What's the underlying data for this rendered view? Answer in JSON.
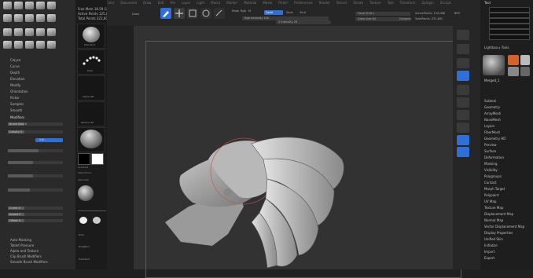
{
  "menubar": {
    "items": [
      "Alpha",
      "Brush",
      "Color",
      "Document",
      "Draw",
      "Edit",
      "File",
      "Layer",
      "Light",
      "Macro",
      "Marker",
      "Material",
      "Movie",
      "Picker",
      "Preferences",
      "Render",
      "Stencil",
      "Stroke",
      "Texture",
      "Tool",
      "Transform",
      "Zplugin",
      "Zscript",
      "Help"
    ]
  },
  "top_status": {
    "line1": "Free Mem 18.59 GB",
    "line2": "Active Points 125,068",
    "line3": "Total Points 321,600"
  },
  "toolbar": {
    "labels": {
      "draw": "Draw",
      "move": "Move",
      "scale": "Scale",
      "rotate": "Rotate",
      "mrgb": "Mrgb",
      "rgb": "Rgb",
      "m": "M",
      "zadd": "Zadd",
      "zsub": "Zsub",
      "zcut": "Zcut",
      "rgb_intensity": "Rgb Intensity 100",
      "z_intensity": "Z Intensity 25",
      "focal_shift": "Focal Shift 0",
      "draw_size": "Draw Size 64",
      "dynamic": "Dynamic",
      "active_points": "ActivePoints: 125,068",
      "total_points": "TotalPoints: 321,600"
    },
    "accent_color": "#2f6fd6"
  },
  "left_panel": {
    "menu": [
      "Clayce",
      "Curve",
      "Depth",
      "Elevation",
      "Modify",
      "Orientation",
      "Picker",
      "Samples",
      "Smooth",
      "Stroke",
      "Surface",
      "Twist"
    ],
    "section_header": "Modifiers",
    "sliders": [
      {
        "label": "Brush Mod 0",
        "level": 0.0
      },
      {
        "label": "Gravity 0",
        "level": 0.0
      },
      {
        "label": "Edit",
        "level": 0.55
      }
    ],
    "bottom_sliders": [
      {
        "label": "Curve 0",
        "level": 0.3
      },
      {
        "label": "Imbed 0",
        "level": 0.3
      },
      {
        "label": "Offset 0",
        "level": 0.3
      }
    ],
    "bottom_menu": [
      "Auto Masking",
      "Tablet Pressure",
      "Alpha and Texture",
      "Clip Brush Modifiers",
      "Smooth Brush Modifiers"
    ]
  },
  "brush_column": {
    "header": "Standard",
    "tiles": [
      "Standard",
      "Dots",
      "",
      "Alpha Off",
      "Texture Off",
      "MatCap Gray"
    ],
    "swatch_labels": [
      "Gradient",
      "SwitchColor",
      "Alternate"
    ],
    "stroke_labels": [
      "Dots",
      "DragRect",
      "FreeHand",
      "Spray"
    ]
  },
  "right_shelf": {
    "buttons": [
      "BPR",
      "SPix",
      "Scroll",
      "Zoom",
      "Actual",
      "AAHalf",
      "Persp",
      "Floor",
      "Local",
      "LSym",
      "Frame",
      "Move",
      "Scale",
      "Rotate",
      "Line Fill",
      "PolyF",
      "Transp",
      "Ghost",
      "Solo",
      "Xpose"
    ],
    "active_index": 5,
    "accent_color": "#2f6fd6"
  },
  "tool_palette": {
    "title": "Tool",
    "buttons": [
      "Load Tool",
      "Save As",
      "Copy Tool",
      "Paste Tool",
      "Import",
      "Export",
      "Clone",
      "Make PolyMesh3D",
      "GoZ",
      "All",
      "Visible",
      "R"
    ],
    "lightbox": "Lightbox ▸ Tools",
    "current_tool": "Merged_1",
    "menu": [
      "Subtool",
      "Geometry",
      "ArrayMesh",
      "NanoMesh",
      "Layers",
      "FiberMesh",
      "Geometry HD",
      "Preview",
      "Surface",
      "Deformation",
      "Masking",
      "Visibility",
      "Polygroups",
      "Contact",
      "Morph Target",
      "Polypaint",
      "UV Map",
      "Texture Map",
      "Displacement Map",
      "Normal Map",
      "Vector Displacement Map",
      "Display Properties",
      "Unified Skin",
      "Initialize",
      "Import",
      "Export"
    ]
  }
}
